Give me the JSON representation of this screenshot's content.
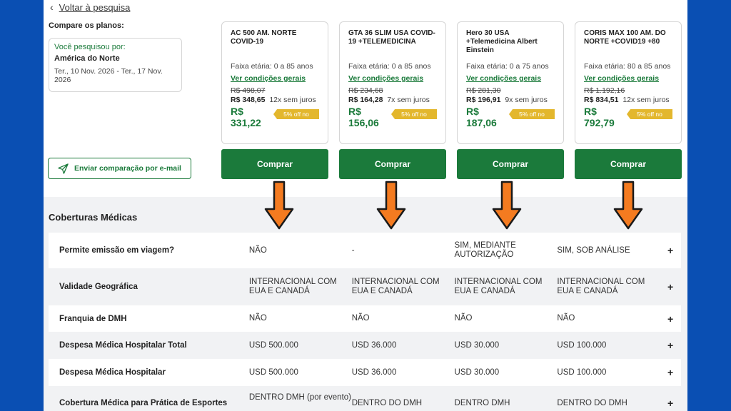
{
  "nav": {
    "back_label": "Voltar à pesquisa"
  },
  "compare": {
    "title": "Compare os planos:",
    "search_label": "Você pesquisou por:",
    "destination": "América do Norte",
    "dates": "Ter., 10 Nov. 2026 - Ter., 17 Nov. 2026",
    "email_button": "Enviar comparação por e-mail"
  },
  "plans": [
    {
      "name": "AC 500 AM. NORTE COVID-19",
      "age": "Faixa etária: 0 a 85 anos",
      "conditions": "Ver condições gerais",
      "old_price": "R$ 498,07",
      "installment_value": "R$ 348,65",
      "installment_terms": "12x sem juros",
      "price": "R$ 331,22",
      "badge": "5% off no",
      "buy": "Comprar"
    },
    {
      "name": "GTA 36 SLIM USA COVID-19 +TELEMEDICINA",
      "age": "Faixa etária: 0 a 85 anos",
      "conditions": "Ver condições gerais",
      "old_price": "R$ 234,68",
      "installment_value": "R$ 164,28",
      "installment_terms": "7x sem juros",
      "price": "R$ 156,06",
      "badge": "5% off no",
      "buy": "Comprar"
    },
    {
      "name": "Hero 30 USA +Telemedicina Albert Einstein",
      "age": "Faixa etária: 0 a 75 anos",
      "conditions": "Ver condições gerais",
      "old_price": "R$ 281,30",
      "installment_value": "R$ 196,91",
      "installment_terms": "9x sem juros",
      "price": "R$ 187,06",
      "badge": "5% off no",
      "buy": "Comprar"
    },
    {
      "name": "CORIS MAX 100 AM. DO NORTE +COVID19 +80",
      "age": "Faixa etária: 80 a 85 anos",
      "conditions": "Ver condições gerais",
      "old_price": "R$ 1.192,16",
      "installment_value": "R$ 834,51",
      "installment_terms": "12x sem juros",
      "price": "R$ 792,79",
      "badge": "5% off no",
      "buy": "Comprar"
    }
  ],
  "coverage": {
    "title": "Coberturas Médicas",
    "rows": [
      {
        "label": "Permite emissão em viagem?",
        "values": [
          "NÃO",
          "-",
          "SIM, MEDIANTE AUTORIZAÇÃO",
          "SIM, SOB ANÁLISE"
        ],
        "plus": "+"
      },
      {
        "label": "Validade Geográfica",
        "values": [
          "INTERNACIONAL COM EUA E CANADÁ",
          "INTERNACIONAL COM EUA E CANADÁ",
          "INTERNACIONAL COM EUA E CANADÁ",
          "INTERNACIONAL COM EUA E CANADÁ"
        ],
        "plus": "+"
      },
      {
        "label": "Franquia de DMH",
        "values": [
          "NÃO",
          "NÃO",
          "NÃO",
          "NÃO"
        ],
        "plus": "+"
      },
      {
        "label": "Despesa Médica Hospitalar Total",
        "values": [
          "USD 500.000",
          "USD 36.000",
          "USD 30.000",
          "USD 100.000"
        ],
        "plus": "+"
      },
      {
        "label": "Despesa Médica Hospitalar",
        "values": [
          "USD 500.000",
          "USD 36.000",
          "USD 30.000",
          "USD 100.000"
        ],
        "plus": "+"
      },
      {
        "label": "Cobertura Médica para Prática de Esportes",
        "values": [
          "DENTRO DMH (por evento)",
          "DENTRO DO DMH",
          "DENTRO DMH",
          "DENTRO DO DMH"
        ],
        "plus": "+"
      }
    ]
  },
  "colors": {
    "brand_green": "#1b7a3b",
    "badge_yellow": "#e3b72d",
    "arrow_orange": "#f47b20",
    "background_blue": "#0a4fb3"
  }
}
